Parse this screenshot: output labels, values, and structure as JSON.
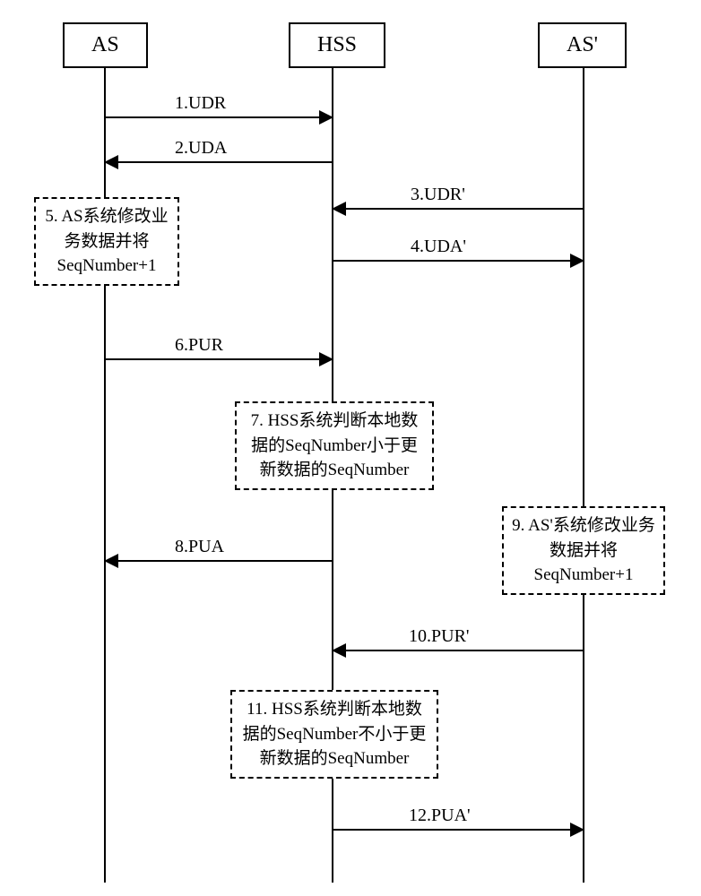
{
  "actors": {
    "as": "AS",
    "hss": "HSS",
    "as2": "AS'"
  },
  "messages": {
    "m1": "1.UDR",
    "m2": "2.UDA",
    "m3": "3.UDR'",
    "m4": "4.UDA'",
    "m6": "6.PUR",
    "m8": "8.PUA",
    "m10": "10.PUR'",
    "m12": "12.PUA'"
  },
  "notes": {
    "n5": "5. AS系统修改业务数据并将SeqNumber+1",
    "n7": "7. HSS系统判断本地数据的SeqNumber小于更新数据的SeqNumber",
    "n9": "9. AS'系统修改业务数据并将SeqNumber+1",
    "n11": "11. HSS系统判断本地数据的SeqNumber不小于更新数据的SeqNumber"
  },
  "chart_data": {
    "type": "sequence_diagram",
    "actors": [
      "AS",
      "HSS",
      "AS'"
    ],
    "steps": [
      {
        "step": 1,
        "from": "AS",
        "to": "HSS",
        "label": "UDR",
        "kind": "message"
      },
      {
        "step": 2,
        "from": "HSS",
        "to": "AS",
        "label": "UDA",
        "kind": "message"
      },
      {
        "step": 3,
        "from": "AS'",
        "to": "HSS",
        "label": "UDR'",
        "kind": "message"
      },
      {
        "step": 4,
        "from": "HSS",
        "to": "AS'",
        "label": "UDA'",
        "kind": "message"
      },
      {
        "step": 5,
        "at": "AS",
        "text": "AS系统修改业务数据并将SeqNumber+1",
        "kind": "note"
      },
      {
        "step": 6,
        "from": "AS",
        "to": "HSS",
        "label": "PUR",
        "kind": "message"
      },
      {
        "step": 7,
        "at": "HSS",
        "text": "HSS系统判断本地数据的SeqNumber小于更新数据的SeqNumber",
        "kind": "note"
      },
      {
        "step": 8,
        "from": "HSS",
        "to": "AS",
        "label": "PUA",
        "kind": "message"
      },
      {
        "step": 9,
        "at": "AS'",
        "text": "AS'系统修改业务数据并将SeqNumber+1",
        "kind": "note"
      },
      {
        "step": 10,
        "from": "AS'",
        "to": "HSS",
        "label": "PUR'",
        "kind": "message"
      },
      {
        "step": 11,
        "at": "HSS",
        "text": "HSS系统判断本地数据的SeqNumber不小于更新数据的SeqNumber",
        "kind": "note"
      },
      {
        "step": 12,
        "from": "HSS",
        "to": "AS'",
        "label": "PUA'",
        "kind": "message"
      }
    ]
  }
}
